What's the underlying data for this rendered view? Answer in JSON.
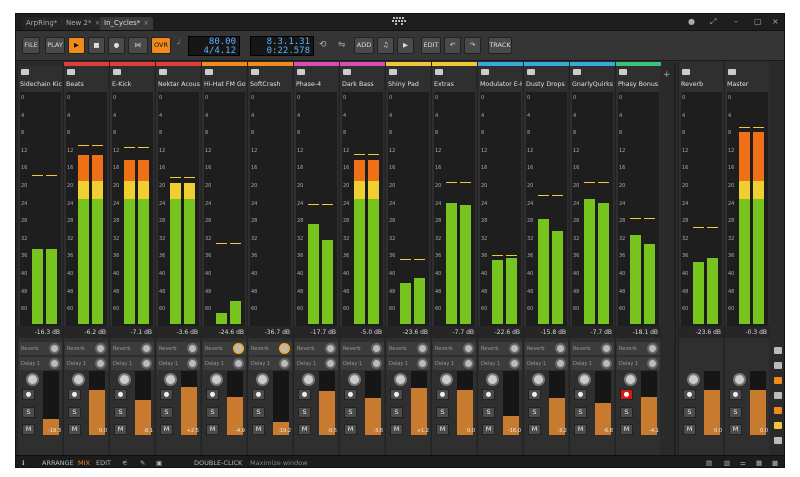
{
  "window": {
    "tabs": [
      {
        "label": "ArpRing*"
      },
      {
        "label": "New 2*"
      },
      {
        "label": "In_Cycles*"
      }
    ]
  },
  "transport": {
    "file": "FILE",
    "play": "PLAY",
    "ovr": "OVR",
    "tempo": "80.00",
    "signature": "4/4.12",
    "position": "8.3.1.31",
    "time": "0:22.578",
    "add": "ADD",
    "edit": "EDIT",
    "track": "TRACK"
  },
  "scale_labels": [
    "0",
    "4",
    "8",
    "12",
    "16",
    "20",
    "24",
    "28",
    "32",
    "36",
    "40",
    "48",
    "60"
  ],
  "send_labels": [
    "Reverb",
    "Delay 1"
  ],
  "button_labels": {
    "solo": "S",
    "mute": "M"
  },
  "channels": [
    {
      "name": "Sidechain Kick",
      "color": "#2a2a2a",
      "db": "-16.3 dB",
      "fader": "-18.3",
      "l": 0.33,
      "r": 0.33,
      "peak": 0.65,
      "f": 0.25
    },
    {
      "name": "Beats",
      "color": "#e03c3c",
      "db": "-6.2 dB",
      "fader": "0.0",
      "l": 0.74,
      "r": 0.74,
      "peak": 0.78,
      "f": 0.7
    },
    {
      "name": "E-Kick",
      "color": "#e03c3c",
      "db": "-7.1 dB",
      "fader": "-8.1",
      "l": 0.72,
      "r": 0.72,
      "peak": 0.77,
      "f": 0.55
    },
    {
      "name": "Nektar Acousti...",
      "color": "#e03c3c",
      "db": "-3.6 dB",
      "fader": "+2.5",
      "l": 0.62,
      "r": 0.62,
      "peak": 0.64,
      "f": 0.75
    },
    {
      "name": "Hi-Hat FM Got...",
      "color": "#f08a1c",
      "db": "-24.6 dB",
      "fader": "-4.9",
      "l": 0.05,
      "r": 0.1,
      "peak": 0.35,
      "f": 0.6
    },
    {
      "name": "SoftCrash",
      "color": "#f08a1c",
      "db": "-36.7 dB",
      "fader": "-19.2",
      "l": 0.0,
      "r": 0.0,
      "peak": 0.0,
      "f": 0.2
    },
    {
      "name": "Phase-4",
      "color": "#d64fb0",
      "db": "-17.7 dB",
      "fader": "-0.5",
      "l": 0.44,
      "r": 0.37,
      "peak": 0.52,
      "f": 0.68
    },
    {
      "name": "Dark Bass",
      "color": "#d64fb0",
      "db": "-5.0 dB",
      "fader": "-3.6",
      "l": 0.72,
      "r": 0.72,
      "peak": 0.74,
      "f": 0.58
    },
    {
      "name": "Shiny Pad",
      "color": "#f0c63a",
      "db": "-23.6 dB",
      "fader": "+1.2",
      "l": 0.18,
      "r": 0.2,
      "peak": 0.28,
      "f": 0.74
    },
    {
      "name": "Extras",
      "color": "#f0c63a",
      "db": "-7.7 dB",
      "fader": "0.0",
      "l": 0.53,
      "r": 0.52,
      "peak": 0.62,
      "f": 0.7
    },
    {
      "name": "Modulator E-H...",
      "color": "#3aa8d8",
      "db": "-22.6 dB",
      "fader": "-16.0",
      "l": 0.28,
      "r": 0.29,
      "peak": 0.3,
      "f": 0.3
    },
    {
      "name": "Dusty Drops",
      "color": "#3aa8d8",
      "db": "-15.8 dB",
      "fader": "-3.2",
      "l": 0.46,
      "r": 0.41,
      "peak": 0.56,
      "f": 0.58
    },
    {
      "name": "GnarlyQuirks",
      "color": "#3aa8d8",
      "db": "-7.7 dB",
      "fader": "-6.8",
      "l": 0.55,
      "r": 0.53,
      "peak": 0.62,
      "f": 0.5
    },
    {
      "name": "Phasy Bonus C...",
      "color": "#3cbf7a",
      "db": "-18.1 dB",
      "fader": "-4.1",
      "l": 0.39,
      "r": 0.35,
      "peak": 0.46,
      "f": 0.6
    }
  ],
  "fx": [
    {
      "name": "Reverb",
      "db": "-23.6 dB",
      "fader": "0.0",
      "l": 0.27,
      "r": 0.29,
      "peak": 0.42,
      "f": 0.7
    }
  ],
  "master": {
    "name": "Master",
    "db": "-0.3 dB",
    "fader": "0.0",
    "l": 0.84,
    "r": 0.84,
    "peak": 0.86,
    "f": 0.7
  },
  "bottom": {
    "arrange": "ARRANGE",
    "mix": "MIX",
    "edit": "EDIT",
    "hint_key": "DOUBLE-CLICK",
    "hint": "Maximize window"
  },
  "colors": {
    "accent": "#f08a1c",
    "meter_green": "#78c41e",
    "meter_yellow": "#f0d030",
    "meter_orange": "#f07018"
  }
}
